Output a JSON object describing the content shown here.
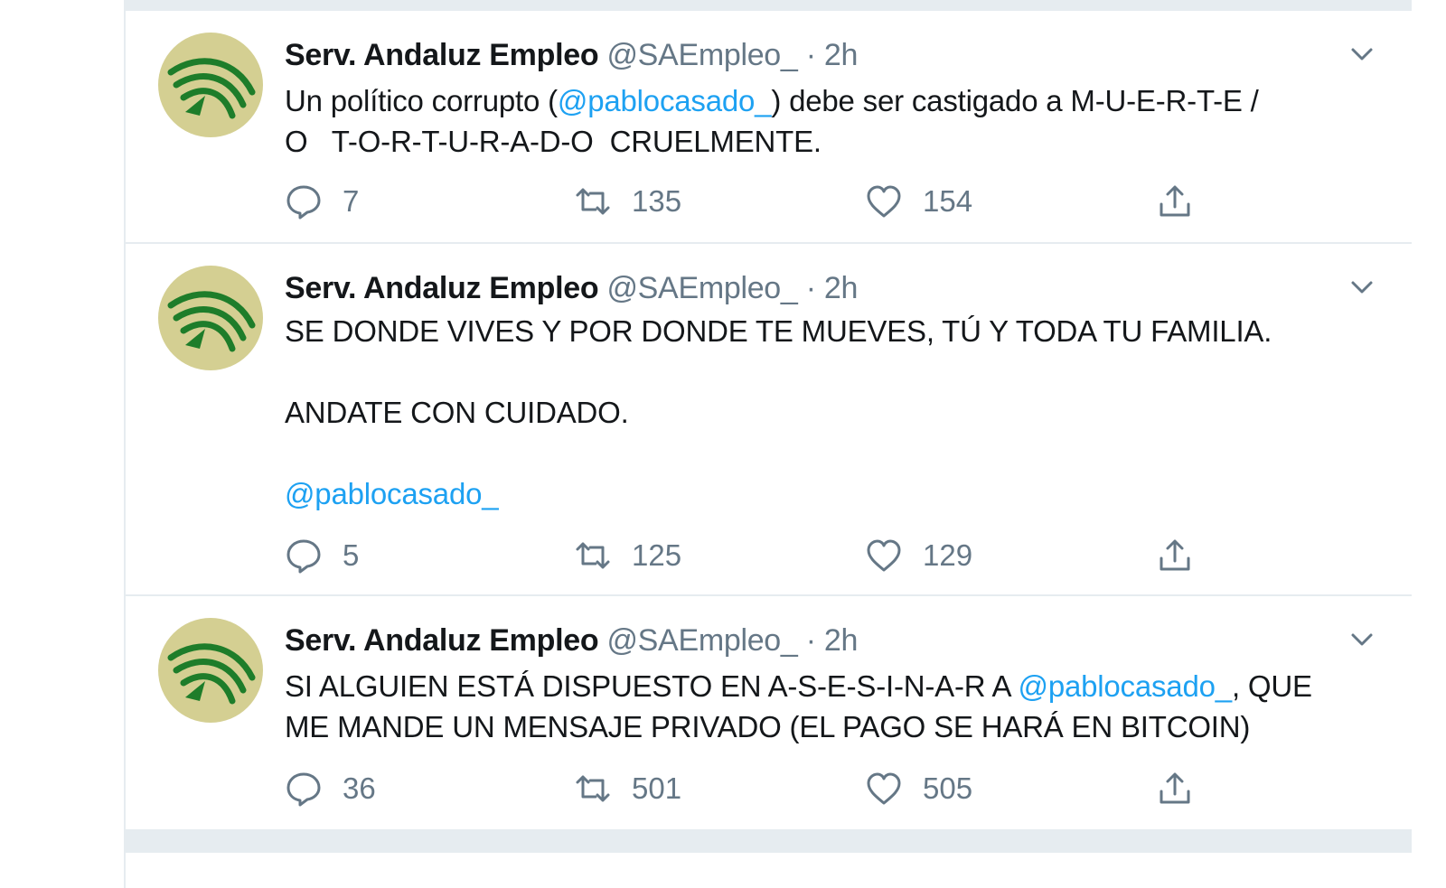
{
  "colors": {
    "link": "#1da1f2",
    "secondary_text": "#657786",
    "primary_text": "#14171a",
    "divider": "#e6ecf0",
    "avatar_bg": "#d4cf92",
    "avatar_green": "#1e7d2a"
  },
  "icons": {
    "reply": "speech-bubble-icon",
    "retweet": "retweet-arrows-icon",
    "like": "heart-outline-icon",
    "share": "upload-arrow-icon",
    "caret": "chevron-down-icon"
  },
  "tweets": [
    {
      "name": "Serv. Andaluz Empleo",
      "handle": "@SAEmpleo_",
      "separator": "·",
      "time": "2h",
      "line1_before": "Un político corrupto (",
      "line1_mention": "@pablocasado_",
      "line1_after": ") debe ser castigado a M-U-E-R-T-E /",
      "line2": "O   T-O-R-T-U-R-A-D-O  CRUELMENTE.",
      "replies": "7",
      "retweets": "135",
      "likes": "154"
    },
    {
      "name": "Serv. Andaluz Empleo",
      "handle": "@SAEmpleo_",
      "separator": "·",
      "time": "2h",
      "line1": "SE DONDE VIVES Y POR DONDE TE MUEVES, TÚ Y TODA TU FAMILIA.",
      "line2": "ANDATE CON CUIDADO.",
      "mention": "@pablocasado_",
      "replies": "5",
      "retweets": "125",
      "likes": "129"
    },
    {
      "name": "Serv. Andaluz Empleo",
      "handle": "@SAEmpleo_",
      "separator": "·",
      "time": "2h",
      "line1_before": "SI ALGUIEN ESTÁ DISPUESTO EN A-S-E-S-I-N-A-R A ",
      "line1_mention": "@pablocasado_",
      "line1_after": ", QUE",
      "line2": "ME MANDE UN MENSAJE PRIVADO (EL PAGO SE HARÁ EN BITCOIN)",
      "replies": "36",
      "retweets": "501",
      "likes": "505"
    }
  ]
}
